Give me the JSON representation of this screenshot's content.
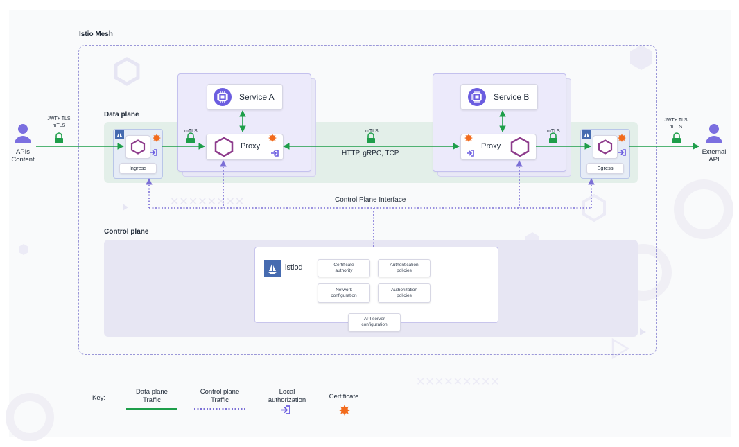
{
  "mesh": {
    "title": "Istio Mesh"
  },
  "data_plane": {
    "title": "Data plane"
  },
  "control_plane": {
    "title": "Control plane"
  },
  "left_client": {
    "line1": "APIs",
    "line2": "Content",
    "sec1": "JWT+ TLS",
    "sec2": "mTLS"
  },
  "right_client": {
    "line1": "External",
    "line2": "API",
    "sec1": "JWT+ TLS",
    "sec2": "mTLS"
  },
  "ingress": {
    "label": "Ingress"
  },
  "egress": {
    "label": "Egress"
  },
  "service_a": {
    "label": "Service A",
    "proxy": "Proxy"
  },
  "service_b": {
    "label": "Service B",
    "proxy": "Proxy"
  },
  "links": {
    "mtls_left": "mTLS",
    "mtls_center": "mTLS",
    "mtls_right": "mTLS",
    "protocols": "HTTP, gRPC, TCP"
  },
  "control_interface": {
    "label": "Control Plane Interface"
  },
  "istiod": {
    "name": "istiod",
    "cert_authority": "Certificate authority",
    "auth_policies": "Authentication policies",
    "network_config": "Network configuration",
    "authz_policies": "Authorization policies",
    "api_server": "API server configuration"
  },
  "key": {
    "title": "Key:",
    "data_traffic_1": "Data plane",
    "data_traffic_2": "Traffic",
    "control_traffic_1": "Control plane",
    "control_traffic_2": "Traffic",
    "local_auth_1": "Local",
    "local_auth_2": "authorization",
    "certificate": "Certificate"
  },
  "colors": {
    "data_traffic": "#1e9e4a",
    "control_traffic": "#7b6fd6",
    "proxy_hex": "#8e3c8c",
    "certificate": "#f26b1d",
    "istio_logo": "#466bb0",
    "person": "#7b6fe0"
  },
  "icons": [
    "person-icon",
    "lock-icon",
    "hexagon-icon",
    "cpu-chip-icon",
    "login-arrow-icon",
    "certificate-icon",
    "istio-sail-icon"
  ]
}
